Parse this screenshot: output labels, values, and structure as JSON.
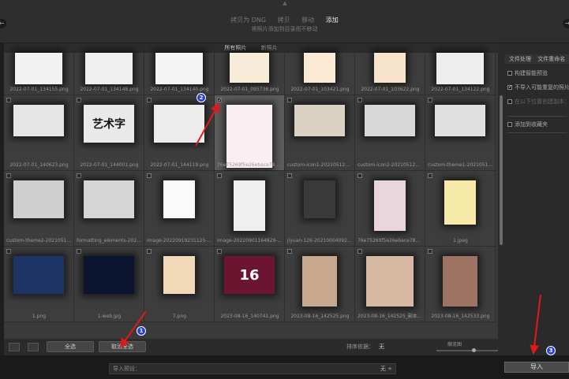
{
  "header": {
    "modes": [
      "拷贝为 DNG",
      "拷贝",
      "移动",
      "添加"
    ],
    "active_mode": 3,
    "subtitle": "将照片添加到目录而不移动",
    "left_arrow": "←",
    "right_arrow": "→",
    "top_notch": "▲"
  },
  "grid_tabs": [
    "所有照片",
    "新照片"
  ],
  "grid_cells": [
    {
      "cap": "2022-07-01_134155.png",
      "chk": ""
    },
    {
      "cap": "2022-07-01_134148.png",
      "chk": ""
    },
    {
      "cap": "2022-07-01_134140.png",
      "chk": ""
    },
    {
      "cap": "2022-07-01_095738.png",
      "chk": ""
    },
    {
      "cap": "2022-07-01_103421.png",
      "chk": ""
    },
    {
      "cap": "2022-07-01_103622.png",
      "chk": ""
    },
    {
      "cap": "2022-07-01_134122.png",
      "chk": ""
    },
    {
      "cap": "2022-07-01_140623.png",
      "chk": ""
    },
    {
      "cap": "2022-07-01_144001.png",
      "chk": ""
    },
    {
      "cap": "2022-07-01_144119.png",
      "chk": ""
    },
    {
      "cap": "76e75269f5e26ebace7878c7d...",
      "chk": "✓"
    },
    {
      "cap": "custom-icon1-20210512172111...",
      "chk": ""
    },
    {
      "cap": "custom-icon2-20210512172111...",
      "chk": ""
    },
    {
      "cap": "custom-theme1-202105121722...",
      "chk": ""
    },
    {
      "cap": "custom-theme2-202105121722...",
      "chk": ""
    },
    {
      "cap": "formatting_elements-2021000...",
      "chk": ""
    },
    {
      "cap": "image-20220919231125-p2oo...",
      "chk": ""
    },
    {
      "cap": "image-20220901164829-wsn...",
      "chk": ""
    },
    {
      "cap": "jiyuan-126-20210004092205-d...",
      "chk": ""
    },
    {
      "cap": "76e75269f5e26ebace7878c7d...",
      "chk": ""
    },
    {
      "cap": "1.jpeg",
      "chk": ""
    },
    {
      "cap": "1.png",
      "chk": ""
    },
    {
      "cap": "1-web.jpg",
      "chk": ""
    },
    {
      "cap": "7.png",
      "chk": ""
    },
    {
      "cap": "2023-08-16_140741.png",
      "chk": ""
    },
    {
      "cap": "2023-08-16_142525.png",
      "chk": ""
    },
    {
      "cap": "2023-08-16_142525_副本.png",
      "chk": ""
    },
    {
      "cap": "2023-08-16_142533.png",
      "chk": ""
    }
  ],
  "thumb_text": {
    "art": "艺术字",
    "num": "16"
  },
  "right_panel": {
    "tabs": [
      "文件处理",
      "文件重命名"
    ],
    "opts": [
      {
        "label": "构建智能预览",
        "checked": false,
        "dim": false
      },
      {
        "label": "不导入可能重复的照片",
        "checked": true,
        "dim": false
      },
      {
        "label": "在以下位置创建副本：",
        "checked": false,
        "dim": true
      },
      {
        "label": "添加到收藏夹",
        "checked": false,
        "dim": false
      }
    ]
  },
  "toolbar": {
    "check_all": "全选",
    "uncheck_all": "取消全选",
    "sort_label": "排序依据：",
    "sort_value": "无",
    "thumb_label": "缩览图"
  },
  "footer": {
    "preset_label": "导入预设：",
    "preset_value": "无 ÷",
    "import": "导入"
  },
  "badges": [
    "1",
    "2",
    "3"
  ],
  "colors": {
    "arrow": "#e01a1a",
    "badge": "#2a3fd6"
  }
}
